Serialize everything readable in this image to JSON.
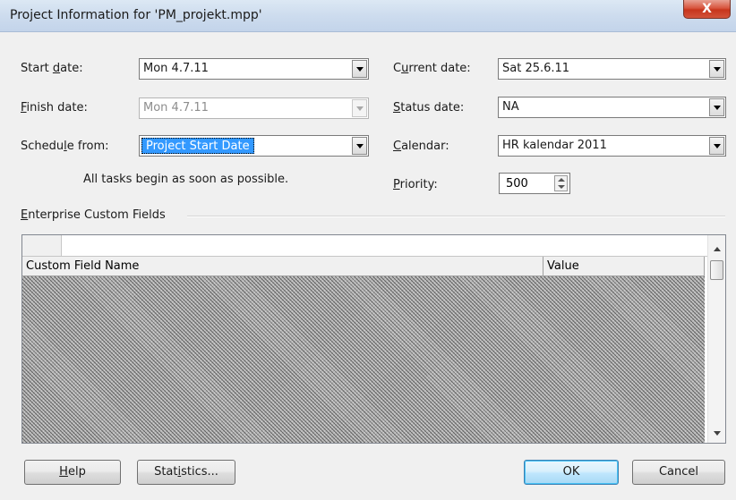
{
  "window": {
    "title": "Project Information for 'PM_projekt.mpp'",
    "close_glyph": "X"
  },
  "fields": {
    "start_date": {
      "label": "Start date:",
      "value": "Mon 4.7.11"
    },
    "finish_date": {
      "label": "Finish date:",
      "value": "Mon 4.7.11",
      "disabled": true
    },
    "schedule_from": {
      "label": "Schedule from:",
      "value": "Project Start Date"
    },
    "current_date": {
      "label": "Current date:",
      "value": "Sat 25.6.11"
    },
    "status_date": {
      "label": "Status date:",
      "value": "NA"
    },
    "calendar": {
      "label": "Calendar:",
      "value": "HR kalendar 2011"
    },
    "priority": {
      "label": "Priority:",
      "value": "500"
    }
  },
  "schedule_note": "All tasks begin as soon as possible.",
  "enterprise": {
    "group_label": "Enterprise Custom Fields",
    "columns": [
      "Custom Field Name",
      "Value"
    ]
  },
  "buttons": {
    "help": "Help",
    "statistics": "Statistics...",
    "ok": "OK",
    "cancel": "Cancel"
  },
  "colors": {
    "selection": "#3399ff",
    "close_button": "#c7351c",
    "dialog_bg": "#f0f0f0"
  },
  "icons": [
    "close-icon",
    "dropdown-arrow-icon",
    "spinner-up-icon",
    "spinner-down-icon",
    "scroll-up-icon",
    "scroll-down-icon"
  ]
}
